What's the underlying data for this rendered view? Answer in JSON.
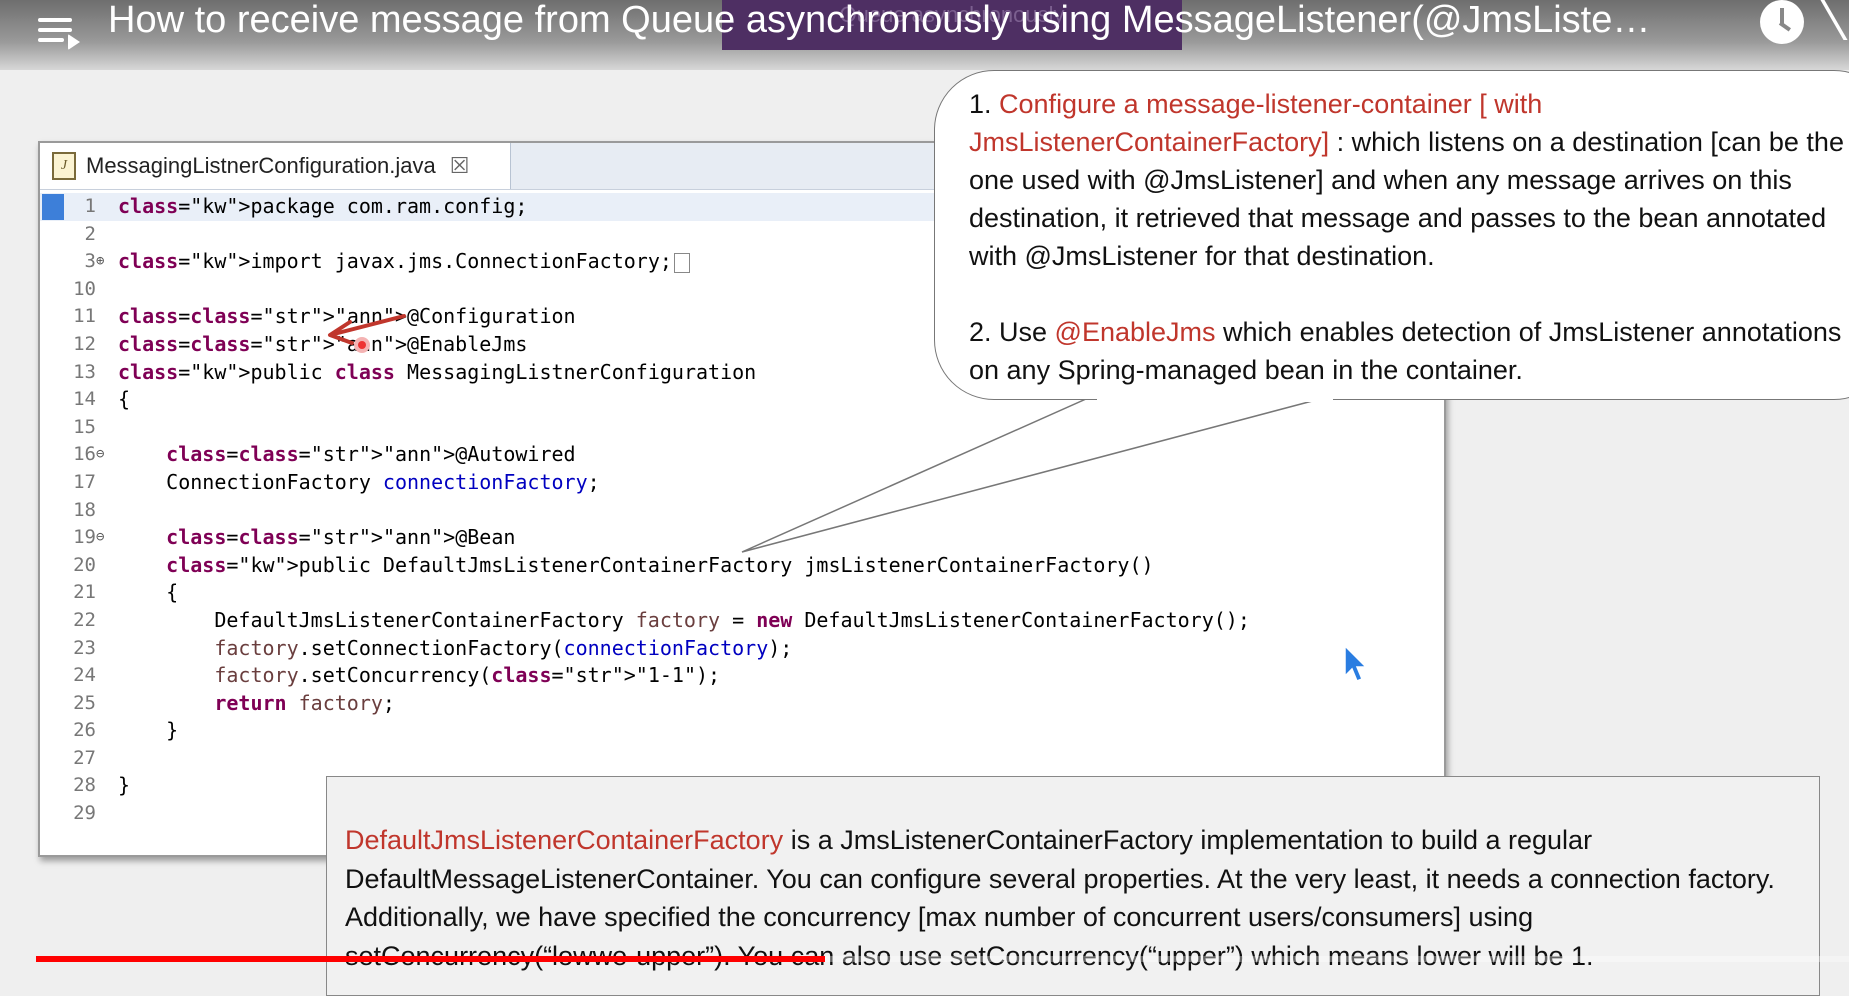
{
  "video": {
    "title": "How to receive message from Queue asynchronously using MessageListener(@JmsListe…",
    "banner_text": "Queue asynchronously",
    "progress": 0.435,
    "progress_color": "#ff0000"
  },
  "icons": {
    "playlist": "playlist-icon",
    "watch_later": "clock-icon",
    "share": "share-icon",
    "java_file": "java-file-icon",
    "close": "close-icon"
  },
  "editor": {
    "tab_label": "MessagingListnerConfiguration.java",
    "tab_icon_letter": "J",
    "close_glyph": "☒",
    "lines": [
      {
        "n": "1",
        "text": "package com.ram.config;"
      },
      {
        "n": "2",
        "text": ""
      },
      {
        "n": "3",
        "marker": "⊕",
        "text": "import javax.jms.ConnectionFactory;"
      },
      {
        "n": "10",
        "text": ""
      },
      {
        "n": "11",
        "text": "@Configuration"
      },
      {
        "n": "12",
        "text": "@EnableJms"
      },
      {
        "n": "13",
        "text": "public class MessagingListnerConfiguration"
      },
      {
        "n": "14",
        "text": "{"
      },
      {
        "n": "15",
        "text": ""
      },
      {
        "n": "16",
        "marker": "⊖",
        "text": "    @Autowired"
      },
      {
        "n": "17",
        "text": "    ConnectionFactory connectionFactory;"
      },
      {
        "n": "18",
        "text": ""
      },
      {
        "n": "19",
        "marker": "⊖",
        "text": "    @Bean"
      },
      {
        "n": "20",
        "text": "    public DefaultJmsListenerContainerFactory jmsListenerContainerFactory()"
      },
      {
        "n": "21",
        "text": "    {"
      },
      {
        "n": "22",
        "text": "        DefaultJmsListenerContainerFactory factory = new DefaultJmsListenerContainerFactory();"
      },
      {
        "n": "23",
        "text": "        factory.setConnectionFactory(connectionFactory);"
      },
      {
        "n": "24",
        "text": "        factory.setConcurrency(\"1-1\");"
      },
      {
        "n": "25",
        "text": "        return factory;"
      },
      {
        "n": "26",
        "text": "    }"
      },
      {
        "n": "27",
        "text": ""
      },
      {
        "n": "28",
        "text": "}"
      },
      {
        "n": "29",
        "text": ""
      }
    ]
  },
  "callout": {
    "p1_number": "1. ",
    "p1_highlight": "Configure a message-listener-container [ with JmsListenerContainerFactory]",
    "p1_rest": " : which listens on a destination [can be the one used with @JmsListener] and when any message arrives on this destination, it retrieved that message and passes to the bean annotated with @JmsListener for that destination.",
    "p2_number": "2. Use ",
    "p2_highlight": "@EnableJms",
    "p2_rest": " which enables detection of JmsListener annotations on any Spring-managed bean in the container."
  },
  "note": {
    "highlight": "DefaultJmsListenerContainerFactory",
    "text": " is a JmsListenerContainerFactory implementation to build a regular DefaultMessageListenerContainer. You can configure several properties. At the very least, it needs a connection factory. Additionally, we have specified the concurrency [max number of concurrent users/consumers] using setConcurrency(“lowwe-upper”). You can also use setConcurrency(“upper”) which means lower will be 1."
  },
  "colors": {
    "highlight_red": "#c0362c",
    "keyword": "#7f0055",
    "annotation": "#646464",
    "field": "#0000c0",
    "string": "#2a00ff"
  }
}
